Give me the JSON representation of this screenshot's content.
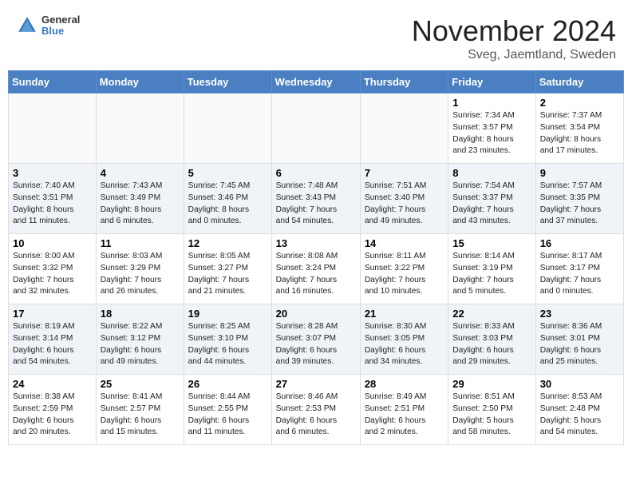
{
  "header": {
    "title": "November 2024",
    "location": "Sveg, Jaemtland, Sweden",
    "logo_general": "General",
    "logo_blue": "Blue"
  },
  "days_of_week": [
    "Sunday",
    "Monday",
    "Tuesday",
    "Wednesday",
    "Thursday",
    "Friday",
    "Saturday"
  ],
  "weeks": [
    [
      {
        "day": "",
        "info": ""
      },
      {
        "day": "",
        "info": ""
      },
      {
        "day": "",
        "info": ""
      },
      {
        "day": "",
        "info": ""
      },
      {
        "day": "",
        "info": ""
      },
      {
        "day": "1",
        "info": "Sunrise: 7:34 AM\nSunset: 3:57 PM\nDaylight: 8 hours\nand 23 minutes."
      },
      {
        "day": "2",
        "info": "Sunrise: 7:37 AM\nSunset: 3:54 PM\nDaylight: 8 hours\nand 17 minutes."
      }
    ],
    [
      {
        "day": "3",
        "info": "Sunrise: 7:40 AM\nSunset: 3:51 PM\nDaylight: 8 hours\nand 11 minutes."
      },
      {
        "day": "4",
        "info": "Sunrise: 7:43 AM\nSunset: 3:49 PM\nDaylight: 8 hours\nand 6 minutes."
      },
      {
        "day": "5",
        "info": "Sunrise: 7:45 AM\nSunset: 3:46 PM\nDaylight: 8 hours\nand 0 minutes."
      },
      {
        "day": "6",
        "info": "Sunrise: 7:48 AM\nSunset: 3:43 PM\nDaylight: 7 hours\nand 54 minutes."
      },
      {
        "day": "7",
        "info": "Sunrise: 7:51 AM\nSunset: 3:40 PM\nDaylight: 7 hours\nand 49 minutes."
      },
      {
        "day": "8",
        "info": "Sunrise: 7:54 AM\nSunset: 3:37 PM\nDaylight: 7 hours\nand 43 minutes."
      },
      {
        "day": "9",
        "info": "Sunrise: 7:57 AM\nSunset: 3:35 PM\nDaylight: 7 hours\nand 37 minutes."
      }
    ],
    [
      {
        "day": "10",
        "info": "Sunrise: 8:00 AM\nSunset: 3:32 PM\nDaylight: 7 hours\nand 32 minutes."
      },
      {
        "day": "11",
        "info": "Sunrise: 8:03 AM\nSunset: 3:29 PM\nDaylight: 7 hours\nand 26 minutes."
      },
      {
        "day": "12",
        "info": "Sunrise: 8:05 AM\nSunset: 3:27 PM\nDaylight: 7 hours\nand 21 minutes."
      },
      {
        "day": "13",
        "info": "Sunrise: 8:08 AM\nSunset: 3:24 PM\nDaylight: 7 hours\nand 16 minutes."
      },
      {
        "day": "14",
        "info": "Sunrise: 8:11 AM\nSunset: 3:22 PM\nDaylight: 7 hours\nand 10 minutes."
      },
      {
        "day": "15",
        "info": "Sunrise: 8:14 AM\nSunset: 3:19 PM\nDaylight: 7 hours\nand 5 minutes."
      },
      {
        "day": "16",
        "info": "Sunrise: 8:17 AM\nSunset: 3:17 PM\nDaylight: 7 hours\nand 0 minutes."
      }
    ],
    [
      {
        "day": "17",
        "info": "Sunrise: 8:19 AM\nSunset: 3:14 PM\nDaylight: 6 hours\nand 54 minutes."
      },
      {
        "day": "18",
        "info": "Sunrise: 8:22 AM\nSunset: 3:12 PM\nDaylight: 6 hours\nand 49 minutes."
      },
      {
        "day": "19",
        "info": "Sunrise: 8:25 AM\nSunset: 3:10 PM\nDaylight: 6 hours\nand 44 minutes."
      },
      {
        "day": "20",
        "info": "Sunrise: 8:28 AM\nSunset: 3:07 PM\nDaylight: 6 hours\nand 39 minutes."
      },
      {
        "day": "21",
        "info": "Sunrise: 8:30 AM\nSunset: 3:05 PM\nDaylight: 6 hours\nand 34 minutes."
      },
      {
        "day": "22",
        "info": "Sunrise: 8:33 AM\nSunset: 3:03 PM\nDaylight: 6 hours\nand 29 minutes."
      },
      {
        "day": "23",
        "info": "Sunrise: 8:36 AM\nSunset: 3:01 PM\nDaylight: 6 hours\nand 25 minutes."
      }
    ],
    [
      {
        "day": "24",
        "info": "Sunrise: 8:38 AM\nSunset: 2:59 PM\nDaylight: 6 hours\nand 20 minutes."
      },
      {
        "day": "25",
        "info": "Sunrise: 8:41 AM\nSunset: 2:57 PM\nDaylight: 6 hours\nand 15 minutes."
      },
      {
        "day": "26",
        "info": "Sunrise: 8:44 AM\nSunset: 2:55 PM\nDaylight: 6 hours\nand 11 minutes."
      },
      {
        "day": "27",
        "info": "Sunrise: 8:46 AM\nSunset: 2:53 PM\nDaylight: 6 hours\nand 6 minutes."
      },
      {
        "day": "28",
        "info": "Sunrise: 8:49 AM\nSunset: 2:51 PM\nDaylight: 6 hours\nand 2 minutes."
      },
      {
        "day": "29",
        "info": "Sunrise: 8:51 AM\nSunset: 2:50 PM\nDaylight: 5 hours\nand 58 minutes."
      },
      {
        "day": "30",
        "info": "Sunrise: 8:53 AM\nSunset: 2:48 PM\nDaylight: 5 hours\nand 54 minutes."
      }
    ]
  ]
}
